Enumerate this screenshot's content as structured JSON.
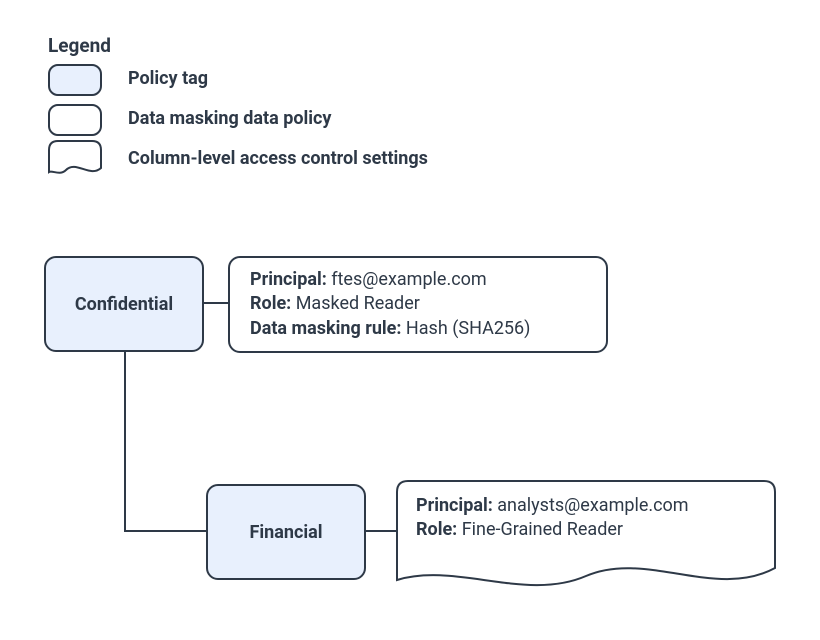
{
  "legend": {
    "title": "Legend",
    "items": [
      {
        "style": "policy-tag",
        "label": "Policy tag"
      },
      {
        "style": "masking",
        "label": "Data masking data policy"
      },
      {
        "style": "acl",
        "label": "Column-level access control settings"
      }
    ]
  },
  "nodes": {
    "confidential": {
      "label": "Confidential",
      "masking": {
        "principal_label": "Principal:",
        "principal_value": "ftes@example.com",
        "role_label": "Role:",
        "role_value": "Masked Reader",
        "rule_label": "Data masking rule:",
        "rule_value": "Hash (SHA256)"
      }
    },
    "financial": {
      "label": "Financial",
      "acl": {
        "principal_label": "Principal:",
        "principal_value": "analysts@example.com",
        "role_label": "Role:",
        "role_value": "Fine-Grained Reader"
      }
    }
  }
}
